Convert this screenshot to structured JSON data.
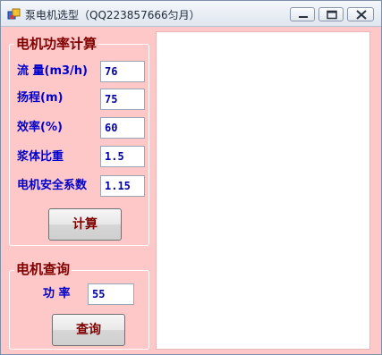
{
  "window": {
    "title": "泵电机选型（QQ223857666匀月）",
    "icons": {
      "app": "app-window-icon",
      "minimize": "minimize-icon",
      "maximize": "maximize-icon",
      "close": "close-icon"
    }
  },
  "power_calc": {
    "caption": "电机功率计算",
    "rows": [
      {
        "label": "流 量(m3/h)",
        "value": "76"
      },
      {
        "label": "扬程(m)",
        "value": "75"
      },
      {
        "label": "效率(%)",
        "value": "60"
      },
      {
        "label": "浆体比重",
        "value": "1.5"
      },
      {
        "label": "电机安全系数",
        "value": "1.15"
      }
    ],
    "button": "计算"
  },
  "motor_query": {
    "caption": "电机查询",
    "power_label": "功 率",
    "power_value": "55",
    "button": "查询"
  },
  "output": {
    "content": ""
  },
  "colors": {
    "background": "#ffc8c8",
    "label": "#0000cc",
    "caption": "#800000"
  }
}
